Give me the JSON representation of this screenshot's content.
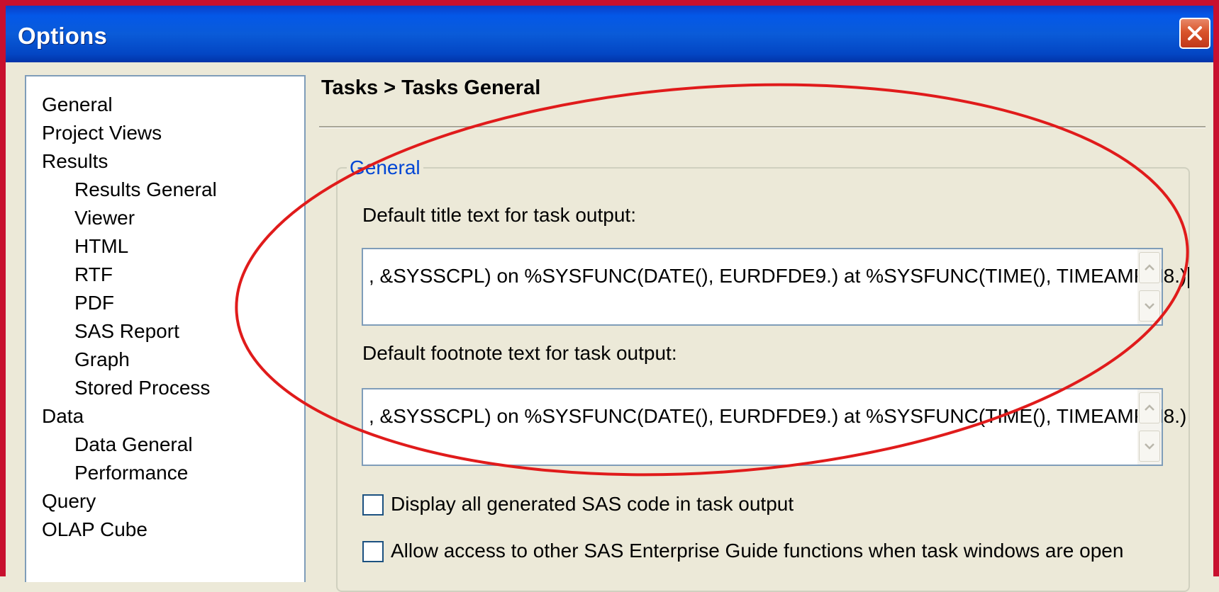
{
  "window": {
    "title": "Options",
    "close_icon": "close-icon"
  },
  "nav": {
    "items": [
      {
        "label": "General",
        "level": 0
      },
      {
        "label": "Project Views",
        "level": 0
      },
      {
        "label": "Results",
        "level": 0
      },
      {
        "label": "Results General",
        "level": 1
      },
      {
        "label": "Viewer",
        "level": 1
      },
      {
        "label": "HTML",
        "level": 1
      },
      {
        "label": "RTF",
        "level": 1
      },
      {
        "label": "PDF",
        "level": 1
      },
      {
        "label": "SAS Report",
        "level": 1
      },
      {
        "label": "Graph",
        "level": 1
      },
      {
        "label": "Stored Process",
        "level": 1
      },
      {
        "label": "Data",
        "level": 0
      },
      {
        "label": "Data General",
        "level": 1
      },
      {
        "label": "Performance",
        "level": 1
      },
      {
        "label": "Query",
        "level": 0
      },
      {
        "label": "OLAP Cube",
        "level": 0
      }
    ]
  },
  "page": {
    "heading": "Tasks > Tasks General",
    "group_label": "General",
    "title_field": {
      "label": "Default title text for task output:",
      "value": ", &SYSSCPL) on %SYSFUNC(DATE(), EURDFDE9.) at %SYSFUNC(TIME(), TIMEAMPM8.)"
    },
    "footnote_field": {
      "label": "Default footnote text for task output:",
      "value": ", &SYSSCPL) on %SYSFUNC(DATE(), EURDFDE9.) at %SYSFUNC(TIME(), TIMEAMPM8.)"
    },
    "checkboxes": [
      {
        "label": "Display all generated SAS code in task output",
        "checked": false
      },
      {
        "label": "Allow access to other SAS Enterprise Guide functions when task windows are open",
        "checked": false
      }
    ]
  },
  "colors": {
    "title_bar": "#0458e8",
    "frame_border": "#c8102e",
    "group_label": "#0046d5",
    "annotation": "#e01b1b"
  }
}
